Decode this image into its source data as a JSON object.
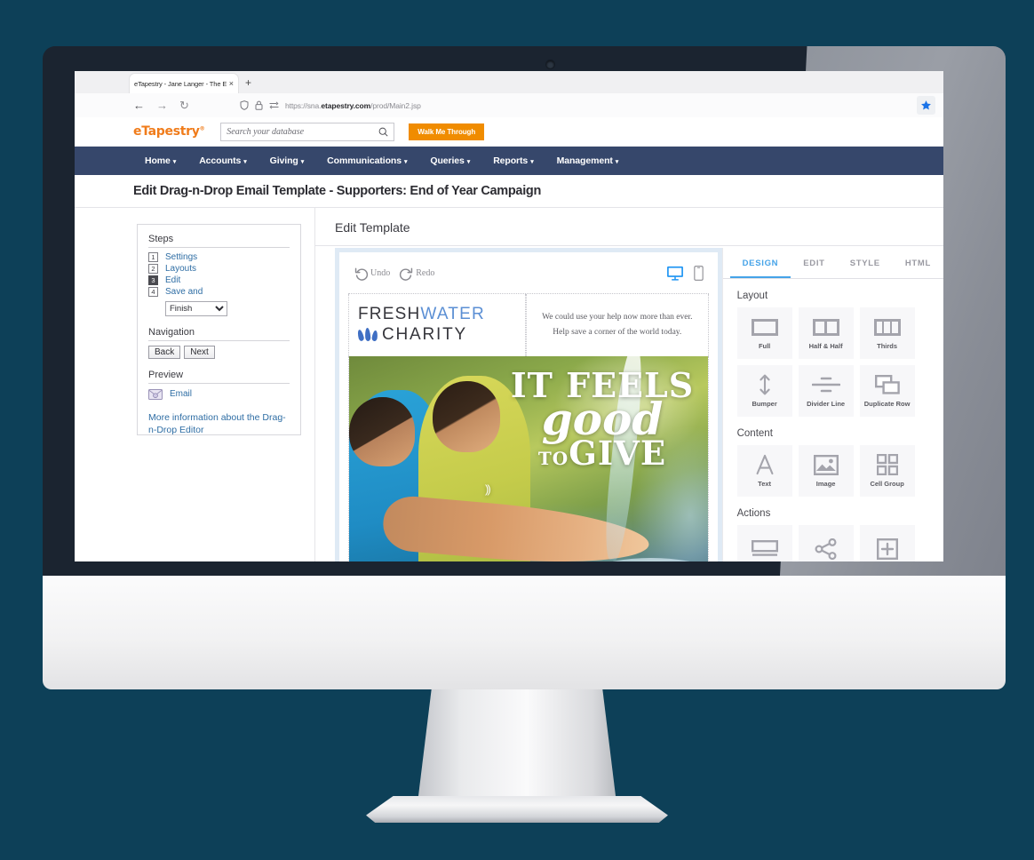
{
  "browser": {
    "tab_title": "eTapestry - Jane Langer - The Excell",
    "tab_close": "×",
    "new_tab": "+",
    "back": "←",
    "forward": "→",
    "reload": "↻",
    "url_prefix": "https://sna.",
    "url_domain": "etapestry.com",
    "url_path": "/prod/Main2.jsp",
    "shield_icon": "shield-icon",
    "lock_icon": "lock-icon",
    "bookmark_icon": "star-icon"
  },
  "app": {
    "brand": "eTapestry",
    "brand_mark": "®",
    "search_placeholder": "Search your database",
    "search_value": "",
    "walk_me_through": "Walk Me Through",
    "nav": [
      {
        "label": "Home",
        "caret": "▾"
      },
      {
        "label": "Accounts",
        "caret": "▾"
      },
      {
        "label": "Giving",
        "caret": "▾"
      },
      {
        "label": "Communications",
        "caret": "▾"
      },
      {
        "label": "Queries",
        "caret": "▾"
      },
      {
        "label": "Reports",
        "caret": "▾"
      },
      {
        "label": "Management",
        "caret": "▾"
      }
    ],
    "page_title": "Edit Drag-n-Drop Email Template - Supporters: End of Year Campaign"
  },
  "sidebar": {
    "steps_heading": "Steps",
    "steps": [
      {
        "num": "1",
        "label": "Settings",
        "active": false
      },
      {
        "num": "2",
        "label": "Layouts",
        "active": false
      },
      {
        "num": "3",
        "label": "Edit",
        "active": true
      },
      {
        "num": "4",
        "label": "Save and",
        "active": false
      }
    ],
    "finish_selected": "Finish",
    "finish_options": [
      "Finish"
    ],
    "navigation_heading": "Navigation",
    "back_label": "Back",
    "next_label": "Next",
    "preview_heading": "Preview",
    "preview_email": "Email",
    "more_info": "More information about the Drag-n-Drop Editor"
  },
  "editor": {
    "title": "Edit Template",
    "undo": "Undo",
    "redo": "Redo",
    "desktop_icon": "desktop-icon",
    "mobile_icon": "mobile-icon",
    "tabs": [
      {
        "label": "DESIGN",
        "active": true
      },
      {
        "label": "EDIT",
        "active": false
      },
      {
        "label": "STYLE",
        "active": false
      },
      {
        "label": "HTML",
        "active": false
      }
    ],
    "sections": [
      {
        "title": "Layout",
        "tiles": [
          {
            "label": "Full",
            "icon": "layout-full-icon"
          },
          {
            "label": "Half & Half",
            "icon": "layout-half-icon"
          },
          {
            "label": "Thirds",
            "icon": "layout-thirds-icon"
          },
          {
            "label": "Bumper",
            "icon": "bumper-icon"
          },
          {
            "label": "Divider Line",
            "icon": "divider-line-icon"
          },
          {
            "label": "Duplicate Row",
            "icon": "duplicate-row-icon"
          }
        ]
      },
      {
        "title": "Content",
        "tiles": [
          {
            "label": "Text",
            "icon": "text-icon"
          },
          {
            "label": "Image",
            "icon": "image-icon"
          },
          {
            "label": "Cell Group",
            "icon": "cell-group-icon"
          }
        ]
      },
      {
        "title": "Actions",
        "tiles": [
          {
            "label": "",
            "icon": "button-icon"
          },
          {
            "label": "",
            "icon": "share-icon"
          },
          {
            "label": "",
            "icon": "plus-box-icon"
          }
        ]
      }
    ]
  },
  "email": {
    "logo_line1_a": "FRESH",
    "logo_line1_b": "WATER",
    "logo_line2": "CHARITY",
    "tagline1": "We could use your help now more than ever.",
    "tagline2": "Help save a corner of the world today.",
    "hero_line1": "IT FEELS",
    "hero_line2": "good",
    "hero_line3_small": "TO",
    "hero_line3_big": "GIVE",
    "hero_alt": "two children playing in splashing water"
  },
  "colors": {
    "background": "#0d4058",
    "brand_orange": "#f07c1b",
    "nav_navy": "#36476b",
    "accent_blue": "#45a3e8",
    "link_blue": "#2e6da4"
  }
}
